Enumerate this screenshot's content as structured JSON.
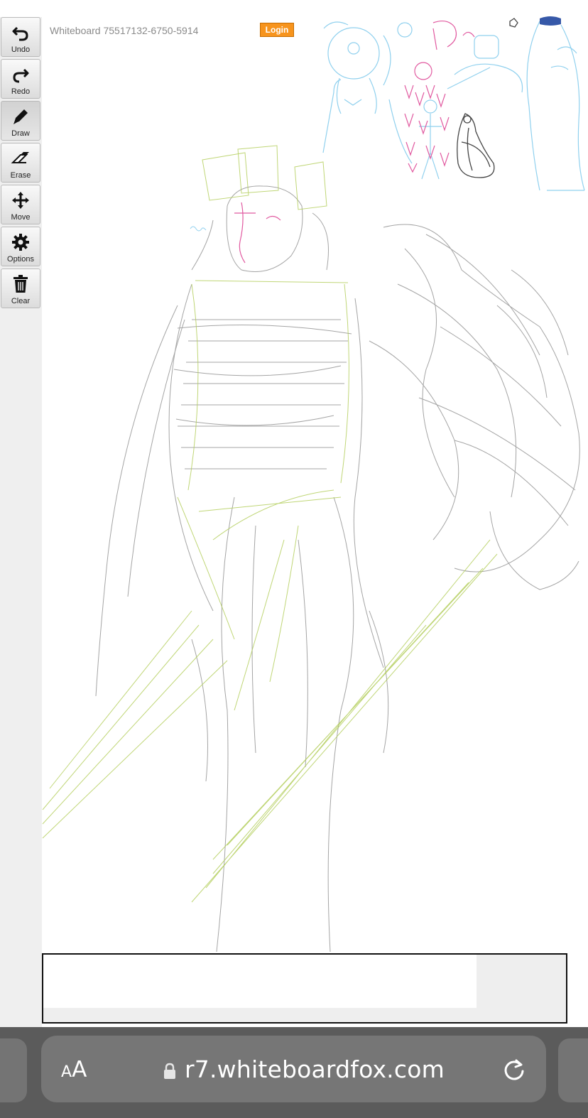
{
  "board": {
    "title": "Whiteboard 75517132-6750-5914",
    "login_label": "Login"
  },
  "toolbar": {
    "tools": [
      {
        "label": "Undo",
        "icon": "undo-icon"
      },
      {
        "label": "Redo",
        "icon": "redo-icon"
      },
      {
        "label": "Draw",
        "icon": "pencil-icon",
        "active": true
      },
      {
        "label": "Erase",
        "icon": "eraser-icon"
      },
      {
        "label": "Move",
        "icon": "move-arrows-icon"
      },
      {
        "label": "Options",
        "icon": "gear-icon"
      },
      {
        "label": "Clear",
        "icon": "trash-icon"
      }
    ]
  },
  "browser": {
    "text_size_label_small": "A",
    "text_size_label_large": "A",
    "url": "r7.whiteboardfox.com",
    "lock_icon": "lock-icon",
    "reload_icon": "reload-icon"
  },
  "colors": {
    "login": "#f7941d",
    "sketch_gray": "#8c8c8c",
    "sketch_green": "#b7cf5a",
    "sketch_blue": "#7fc6ea",
    "sketch_pink": "#e0489a",
    "browser_bar": "#5b5b5b"
  }
}
